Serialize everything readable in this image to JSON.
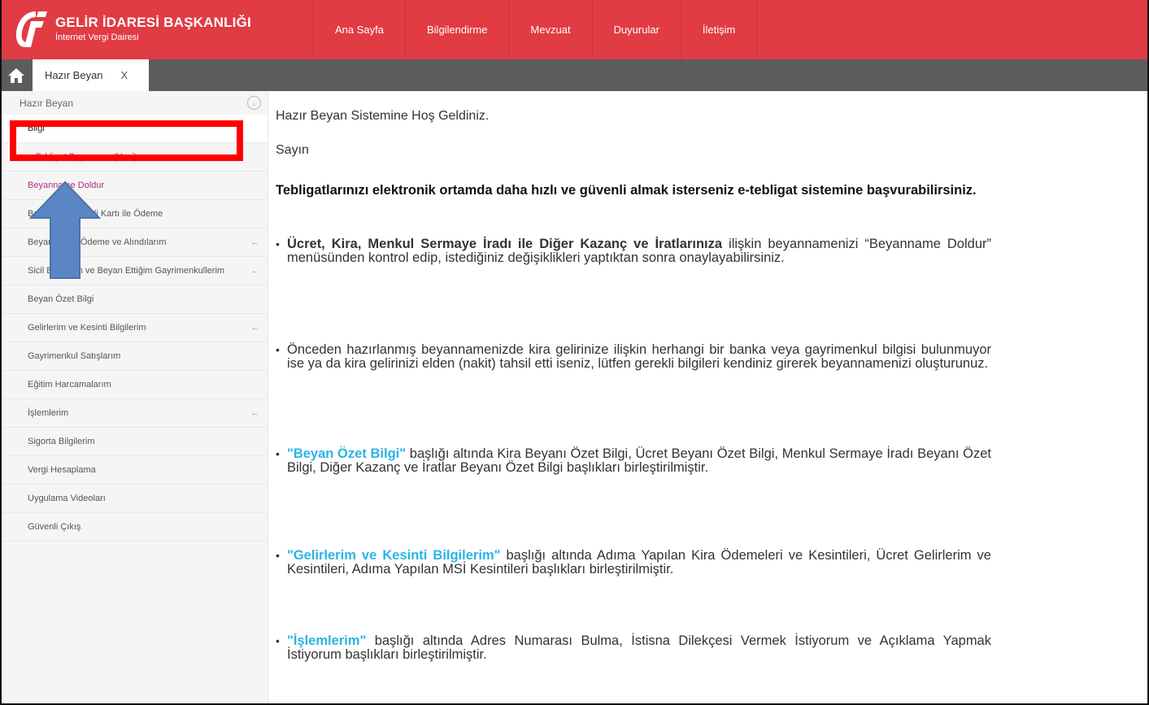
{
  "header": {
    "title": "GELİR İDARESİ BAŞKANLIĞI",
    "subtitle": "İnternet Vergi Dairesi",
    "brand_color": "#e13b44",
    "nav": [
      "Ana Sayfa",
      "Bilgilendirme",
      "Mevzuat",
      "Duyurular",
      "İletişim"
    ]
  },
  "tabbar": {
    "home_icon": "home-icon",
    "tab_label": "Hazır Beyan",
    "tab_close": "X"
  },
  "sidebar": {
    "heading": "Hazır Beyan",
    "items": [
      {
        "label": "Bilgi",
        "has_arrow": false
      },
      {
        "label": "e-Tebligat Başvurusu",
        "tag": "(Yeni)",
        "has_arrow": false
      },
      {
        "label": "Beyanname Doldur",
        "has_arrow": false
      },
      {
        "label": "Banka Kartı-Kredi Kartı ile Ödeme",
        "has_arrow": false
      },
      {
        "label": "Beyanname, Ödeme ve Alındılarım",
        "has_arrow": true
      },
      {
        "label": "Sicil Bilgilerim ve Beyan Ettiğim Gayrimenkullerim",
        "has_arrow": true
      },
      {
        "label": "Beyan Özet Bilgi",
        "has_arrow": false
      },
      {
        "label": "Gelirlerim ve Kesinti Bilgilerim",
        "has_arrow": true
      },
      {
        "label": "Gayrimenkul Satışlarım",
        "has_arrow": false
      },
      {
        "label": "Eğitim Harcamalarım",
        "has_arrow": false
      },
      {
        "label": "İşlemlerim",
        "has_arrow": true
      },
      {
        "label": "Sigorta Bilgilerim",
        "has_arrow": false
      },
      {
        "label": "Vergi Hesaplama",
        "has_arrow": false
      },
      {
        "label": "Uygulama Videoları",
        "has_arrow": false
      },
      {
        "label": "Güvenli Çıkış",
        "has_arrow": false
      }
    ],
    "arrow_glyph": "←"
  },
  "main": {
    "welcome": "Hazır Beyan Sistemine Hoş Geldiniz.",
    "greeting": "Sayın",
    "notice": "Tebligatlarınızı elektronik ortamda daha hızlı ve güvenli almak isterseniz e-tebligat sistemine başvurabilirsiniz.",
    "b1_bold": "Ücret, Kira, Menkul Sermaye İradı ile Diğer Kazanç ve İratlarınıza",
    "b1_text": " ilişkin beyannamenizi “Beyanname Doldur” menüsünden kontrol edip, istediğiniz değişiklikleri yaptıktan sonra onaylayabilirsiniz.",
    "b2_text": "Önceden hazırlanmış beyannamenizde kira gelirinize ilişkin herhangi bir banka veya gayrimenkul bilgisi bulunmuyor ise ya da kira gelirinizi elden (nakit) tahsil etti iseniz, lütfen gerekli bilgileri kendiniz girerek beyannamenizi oluşturunuz.",
    "b3_link": "\"Beyan Özet Bilgi\"",
    "b3_text": " başlığı altında Kira Beyanı Özet Bilgi, Ücret Beyanı Özet Bilgi, Menkul Sermaye İradı Beyanı Özet Bilgi, Diğer Kazanç ve İratlar Beyanı Özet Bilgi başlıkları birleştirilmiştir.",
    "b4_link": "\"Gelirlerim ve Kesinti Bilgilerim\"",
    "b4_text": " başlığı altında Adıma Yapılan Kira Ödemeleri ve Kesintileri, Ücret Gelirlerim ve Kesintileri, Adıma Yapılan MSİ Kesintileri başlıkları birleştirilmiştir.",
    "b5_link": "\"İşlemlerim\"",
    "b5_text": " başlığı altında Adres Numarası Bulma, İstisna Dilekçesi Vermek İstiyorum ve Açıklama Yapmak İstiyorum başlıkları birleştirilmiştir.",
    "link_color": "#2bb3e6"
  },
  "annotations": {
    "highlight_color": "#ff0000",
    "arrow_color": "#5b86c5"
  }
}
